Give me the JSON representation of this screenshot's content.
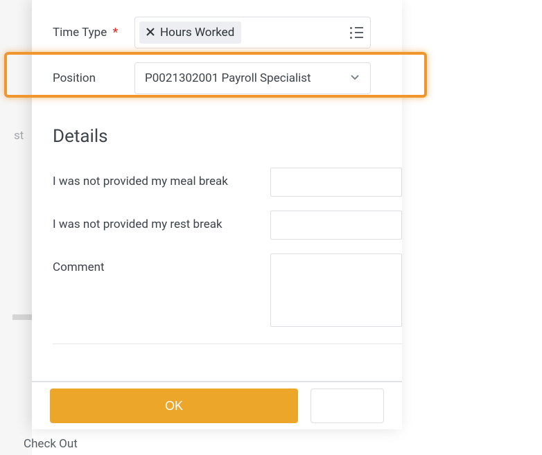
{
  "bg": {
    "partial_text": "st",
    "bottom_button_partial": "Check Out"
  },
  "timeType": {
    "label": "Time Type",
    "pill": "Hours Worked"
  },
  "position": {
    "label": "Position",
    "value": "P0021302001 Payroll Specialist"
  },
  "details": {
    "heading": "Details",
    "meal_label": "I was not provided my meal break",
    "rest_label": "I was not provided my rest break",
    "comment_label": "Comment"
  },
  "buttons": {
    "ok": "OK"
  }
}
